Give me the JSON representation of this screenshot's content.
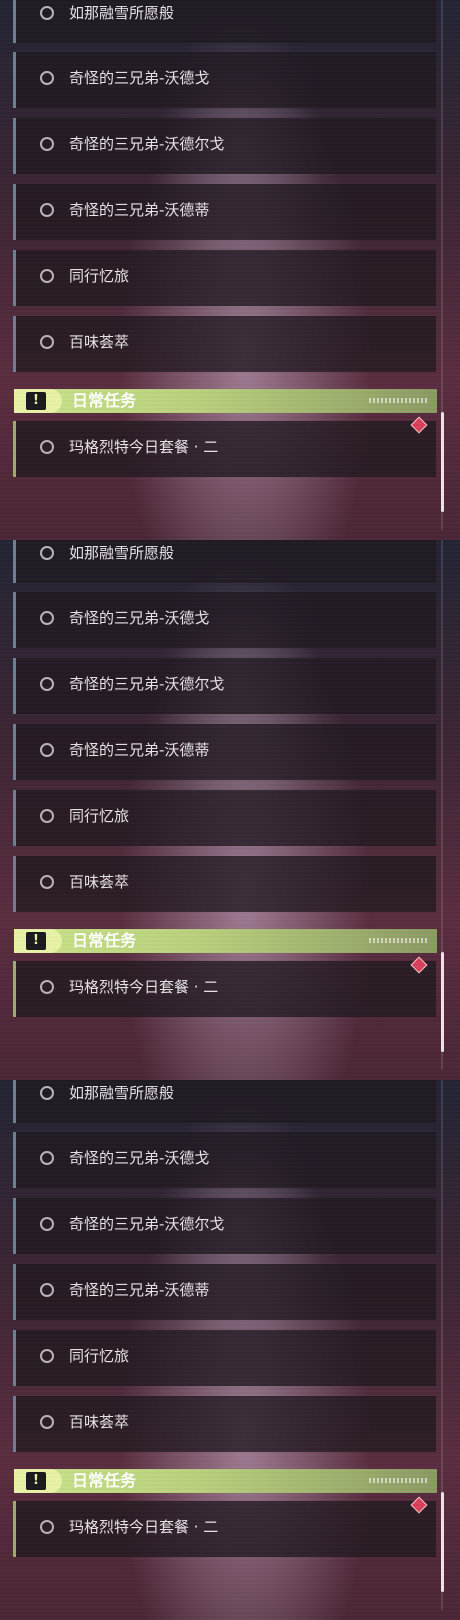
{
  "quests": [
    {
      "title": "如那融雪所愿般"
    },
    {
      "title": "奇怪的三兄弟-沃德戈"
    },
    {
      "title": "奇怪的三兄弟-沃德尔戈"
    },
    {
      "title": "奇怪的三兄弟-沃德蒂"
    },
    {
      "title": "同行忆旅"
    },
    {
      "title": "百味荟萃"
    }
  ],
  "daily_section": {
    "title": "日常任务",
    "icon": "exclamation-icon",
    "quests": [
      {
        "title": "玛格烈特今日套餐 · 二"
      }
    ]
  },
  "colors": {
    "header_green": "#c9e389",
    "row_accent": "#6d7f92",
    "marker": "#d9405a"
  }
}
